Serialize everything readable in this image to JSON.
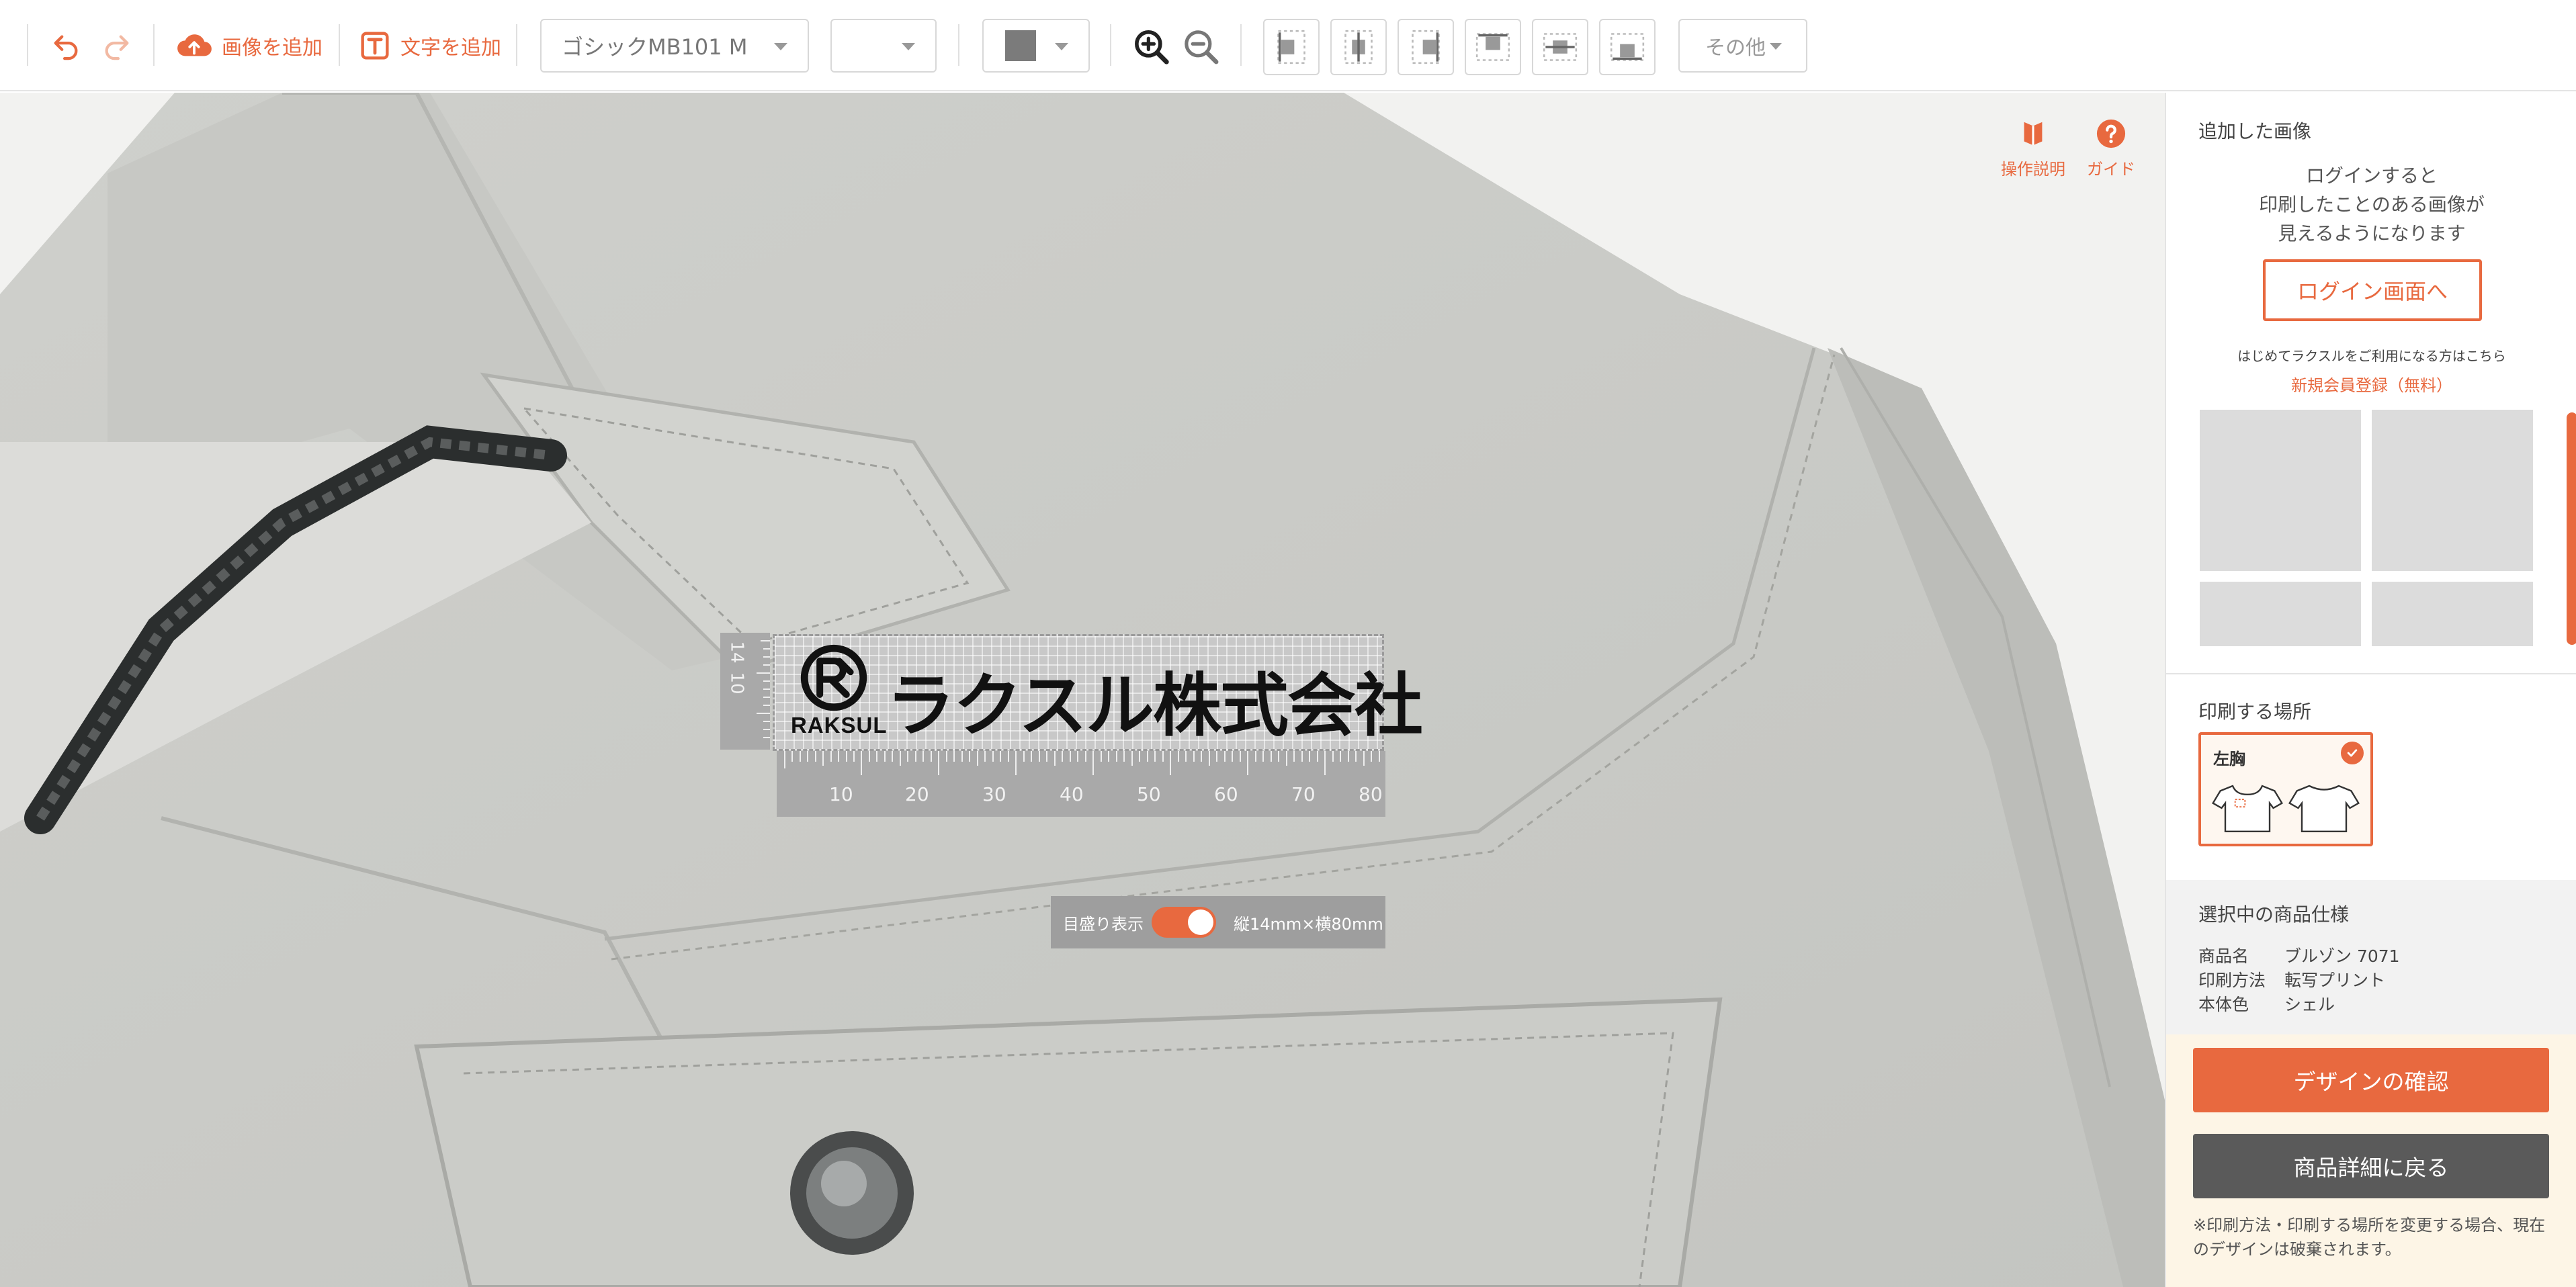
{
  "toolbar": {
    "add_image": "画像を追加",
    "add_text": "文字を追加",
    "font": "ゴシックMB101 M",
    "size": "",
    "more": "その他"
  },
  "canvas": {
    "help_manual": "操作説明",
    "help_guide": "ガイド",
    "design": {
      "logo_text": "RAKSUL",
      "company": "ラクスル株式会社",
      "vruler_labels": [
        "14",
        "10"
      ],
      "hruler_labels": [
        "10",
        "20",
        "30",
        "40",
        "50",
        "60",
        "70",
        "80"
      ]
    },
    "scale_toggle_label": "目盛り表示",
    "size_readout": "縦14mm×横80mm"
  },
  "panel": {
    "added_images_title": "追加した画像",
    "login_message": [
      "ログインすると",
      "印刷したことのある画像が",
      "見えるようになります"
    ],
    "login_button": "ログイン画面へ",
    "first_time": "はじめてラクスルをご利用になる方はこちら",
    "register_link": "新規会員登録（無料）",
    "print_place_title": "印刷する場所",
    "print_place_selected": "左胸",
    "spec_title": "選択中の商品仕様",
    "spec": [
      {
        "key": "商品名",
        "value": "ブルゾン 7071"
      },
      {
        "key": "印刷方法",
        "value": "転写プリント"
      },
      {
        "key": "本体色",
        "value": "シェル"
      }
    ],
    "confirm_button": "デザインの確認",
    "back_button": "商品詳細に戻る",
    "note": "※印刷方法・印刷する場所を変更する場合、現在のデザインは破棄されます。"
  },
  "colors": {
    "accent": "#e8693f",
    "dark_button": "#5a5a5a",
    "jacket": "#c9cac6"
  }
}
